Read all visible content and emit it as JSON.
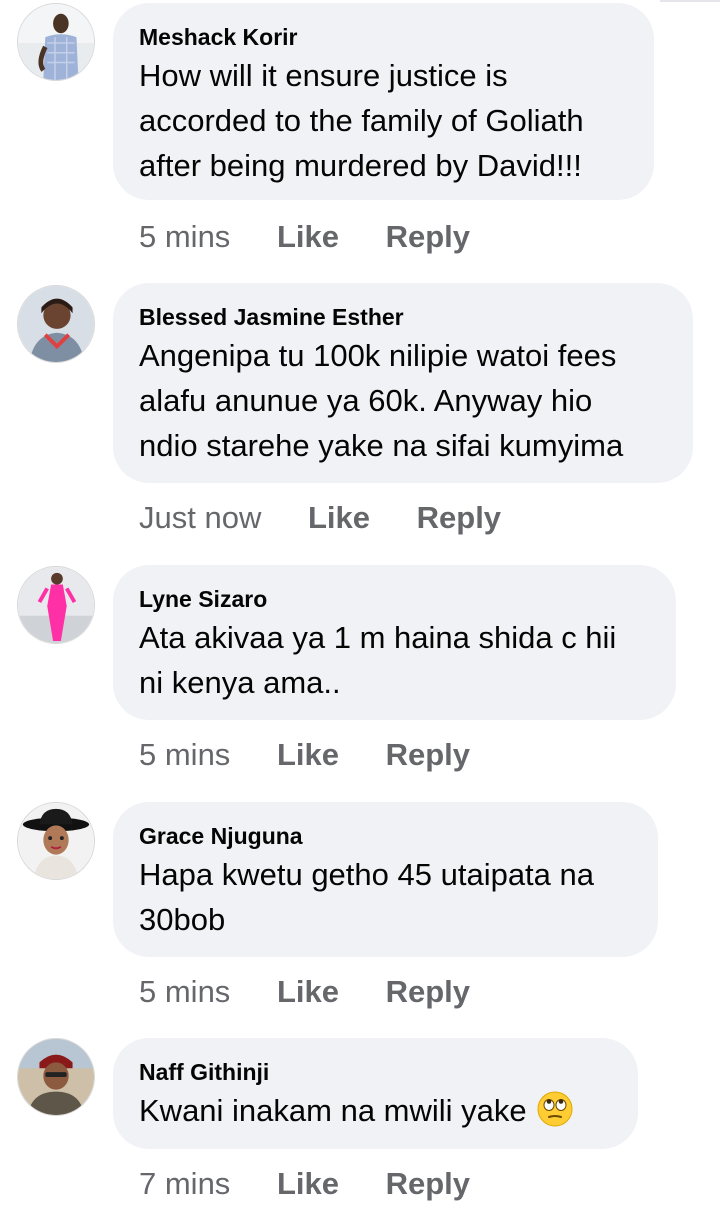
{
  "comments": [
    {
      "author": "Meshack Korir",
      "lines": [
        "How will it ensure justice is",
        "accorded to the family of Goliath",
        "after being murdered by David!!!"
      ],
      "time": "5 mins",
      "like": "Like",
      "reply": "Reply"
    },
    {
      "author": "Blessed Jasmine Esther",
      "lines": [
        "Angenipa tu 100k nilipie watoi fees",
        "alafu anunue ya 60k. Anyway hio",
        "ndio starehe yake na sifai kumyima"
      ],
      "time": "Just now",
      "like": "Like",
      "reply": "Reply"
    },
    {
      "author": "Lyne Sizaro",
      "lines": [
        "Ata akivaa ya 1 m haina shida c hii",
        "ni kenya ama.."
      ],
      "time": "5 mins",
      "like": "Like",
      "reply": "Reply"
    },
    {
      "author": "Grace Njuguna",
      "lines": [
        "Hapa kwetu getho 45 utaipata na",
        "30bob"
      ],
      "time": "5 mins",
      "like": "Like",
      "reply": "Reply"
    },
    {
      "author": "Naff Githinji",
      "lines": [
        "Kwani inakam na mwili yake"
      ],
      "emoji": "face-with-rolling-eyes-emoji",
      "time": "7 mins",
      "like": "Like",
      "reply": "Reply"
    }
  ]
}
